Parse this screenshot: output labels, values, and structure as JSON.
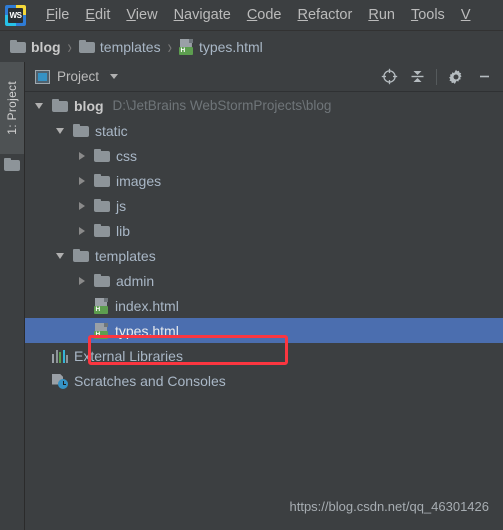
{
  "app": {
    "logo_text": "WS",
    "logo_name": "webstorm-logo"
  },
  "menubar": {
    "items": [
      {
        "label": "File",
        "mnemonic": "F",
        "rest": "ile"
      },
      {
        "label": "Edit",
        "mnemonic": "E",
        "rest": "dit"
      },
      {
        "label": "View",
        "mnemonic": "V",
        "rest": "iew"
      },
      {
        "label": "Navigate",
        "mnemonic": "N",
        "rest": "avigate"
      },
      {
        "label": "Code",
        "mnemonic": "C",
        "rest": "ode"
      },
      {
        "label": "Refactor",
        "mnemonic": "R",
        "rest": "efactor"
      },
      {
        "label": "Run",
        "mnemonic": "R",
        "rest": "un"
      },
      {
        "label": "Tools",
        "mnemonic": "T",
        "rest": "ools"
      },
      {
        "label": "V",
        "mnemonic": "V",
        "rest": ""
      }
    ]
  },
  "breadcrumb": {
    "separator": "›",
    "items": [
      {
        "label": "blog",
        "icon": "folder-icon",
        "bold": true
      },
      {
        "label": "templates",
        "icon": "folder-icon",
        "bold": false
      },
      {
        "label": "types.html",
        "icon": "html-file-icon",
        "bold": false
      }
    ]
  },
  "toolstrip": {
    "tab_label": "1: Project",
    "folder_button": "folder-icon"
  },
  "panel": {
    "title": "Project",
    "icons": {
      "panel": "project-view-icon",
      "dropdown": "chevron-down-icon",
      "locate": "locate-target-icon",
      "collapse_all": "collapse-all-icon",
      "settings": "gear-icon",
      "minimize": "minimize-icon"
    }
  },
  "tree": {
    "rows": [
      {
        "label": "blog",
        "path": "D:\\JetBrains WebStormProjects\\blog",
        "icon": "folder-icon",
        "arrow": "expanded",
        "depth": 0,
        "bold": true,
        "selected": false
      },
      {
        "label": "static",
        "path": "",
        "icon": "folder-icon",
        "arrow": "expanded",
        "depth": 1,
        "bold": false,
        "selected": false
      },
      {
        "label": "css",
        "path": "",
        "icon": "folder-icon",
        "arrow": "collapsed",
        "depth": 2,
        "bold": false,
        "selected": false
      },
      {
        "label": "images",
        "path": "",
        "icon": "folder-icon",
        "arrow": "collapsed",
        "depth": 2,
        "bold": false,
        "selected": false
      },
      {
        "label": "js",
        "path": "",
        "icon": "folder-icon",
        "arrow": "collapsed",
        "depth": 2,
        "bold": false,
        "selected": false
      },
      {
        "label": "lib",
        "path": "",
        "icon": "folder-icon",
        "arrow": "collapsed",
        "depth": 2,
        "bold": false,
        "selected": false
      },
      {
        "label": "templates",
        "path": "",
        "icon": "folder-icon",
        "arrow": "expanded",
        "depth": 1,
        "bold": false,
        "selected": false
      },
      {
        "label": "admin",
        "path": "",
        "icon": "folder-icon",
        "arrow": "collapsed",
        "depth": 2,
        "bold": false,
        "selected": false
      },
      {
        "label": "index.html",
        "path": "",
        "icon": "html-file-icon",
        "arrow": "none",
        "depth": 2,
        "bold": false,
        "selected": false
      },
      {
        "label": "types.html",
        "path": "",
        "icon": "html-file-icon",
        "arrow": "none",
        "depth": 2,
        "bold": false,
        "selected": true
      },
      {
        "label": "External Libraries",
        "path": "",
        "icon": "external-libraries-icon",
        "arrow": "none",
        "depth": 0,
        "bold": false,
        "selected": false
      },
      {
        "label": "Scratches and Consoles",
        "path": "",
        "icon": "scratches-icon",
        "arrow": "none",
        "depth": 0,
        "bold": false,
        "selected": false
      }
    ],
    "html_badge_letter": "H"
  },
  "annotation": {
    "color": "#fb3640",
    "target": "types.html"
  },
  "watermark": {
    "text": "https://blog.csdn.net/qq_46301426"
  },
  "colors": {
    "background": "#3c3f41",
    "selection": "#4b6eaf",
    "text": "#a9b7c6",
    "muted": "#6f7579",
    "annotation": "#fb3640"
  }
}
